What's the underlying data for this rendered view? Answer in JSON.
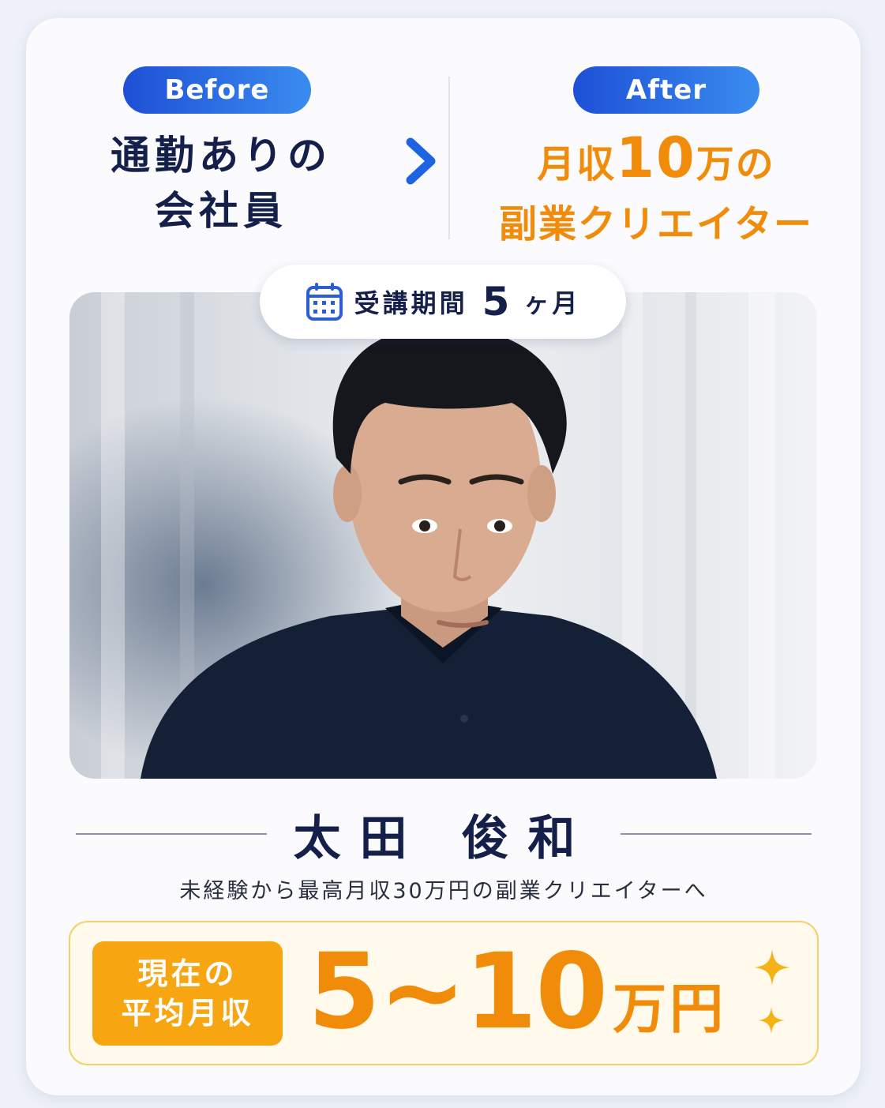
{
  "before": {
    "badge": "Before",
    "lines": [
      "通勤ありの",
      "会社員"
    ]
  },
  "after": {
    "badge": "After",
    "line1_prefix": "月収",
    "line1_number": "10",
    "line1_suffix": "万の",
    "line2": "副業クリエイター"
  },
  "period": {
    "icon": "calendar-icon",
    "label": "受講期間",
    "number": "5",
    "unit": "ヶ月"
  },
  "photo": {
    "description_icon": "portrait-photo"
  },
  "person": {
    "name": "太田 俊和",
    "subtitle": "未経験から最高月収30万円の副業クリエイターへ"
  },
  "result": {
    "label_lines": [
      "現在の",
      "平均月収"
    ],
    "amount": "5~10",
    "unit": "万円",
    "icon": "sparkle-icon"
  },
  "colors": {
    "navy": "#14204a",
    "orange": "#f08c0a",
    "blue_start": "#1e50d6",
    "blue_end": "#3a8cf0",
    "label_orange": "#f7a612"
  }
}
